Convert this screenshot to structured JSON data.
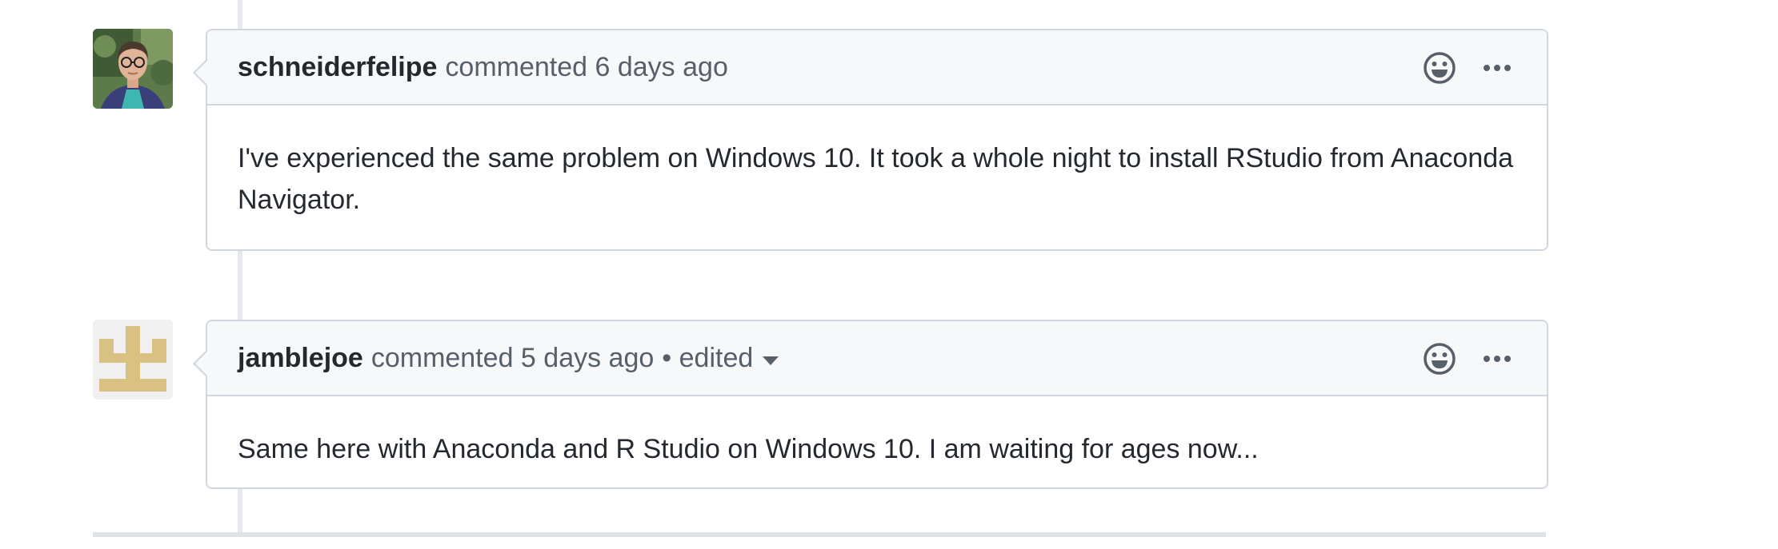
{
  "comments": [
    {
      "author": "schneiderfelipe",
      "action_text": "commented 6 days ago",
      "edited_text": "",
      "body": "I've experienced the same problem on Windows 10. It took a whole night to install RStudio from Anaconda Navigator.",
      "avatar_icon": "user-photo-avatar",
      "reaction_icon": "smiley-icon",
      "more_icon": "kebab-horizontal-icon"
    },
    {
      "author": "jamblejoe",
      "action_text": "commented 5 days ago",
      "edited_text": "• edited",
      "body": "Same here with Anaconda and R Studio on Windows 10. I am waiting for ages now...",
      "avatar_icon": "identicon-avatar",
      "reaction_icon": "smiley-icon",
      "more_icon": "kebab-horizontal-icon"
    }
  ],
  "colors": {
    "header_bg": "#f6f8fa",
    "border": "#d0d7de",
    "text_primary": "#24292f",
    "text_secondary": "#57606a",
    "identicon": "#d8c182",
    "identicon_bg": "#f0f0f0"
  }
}
